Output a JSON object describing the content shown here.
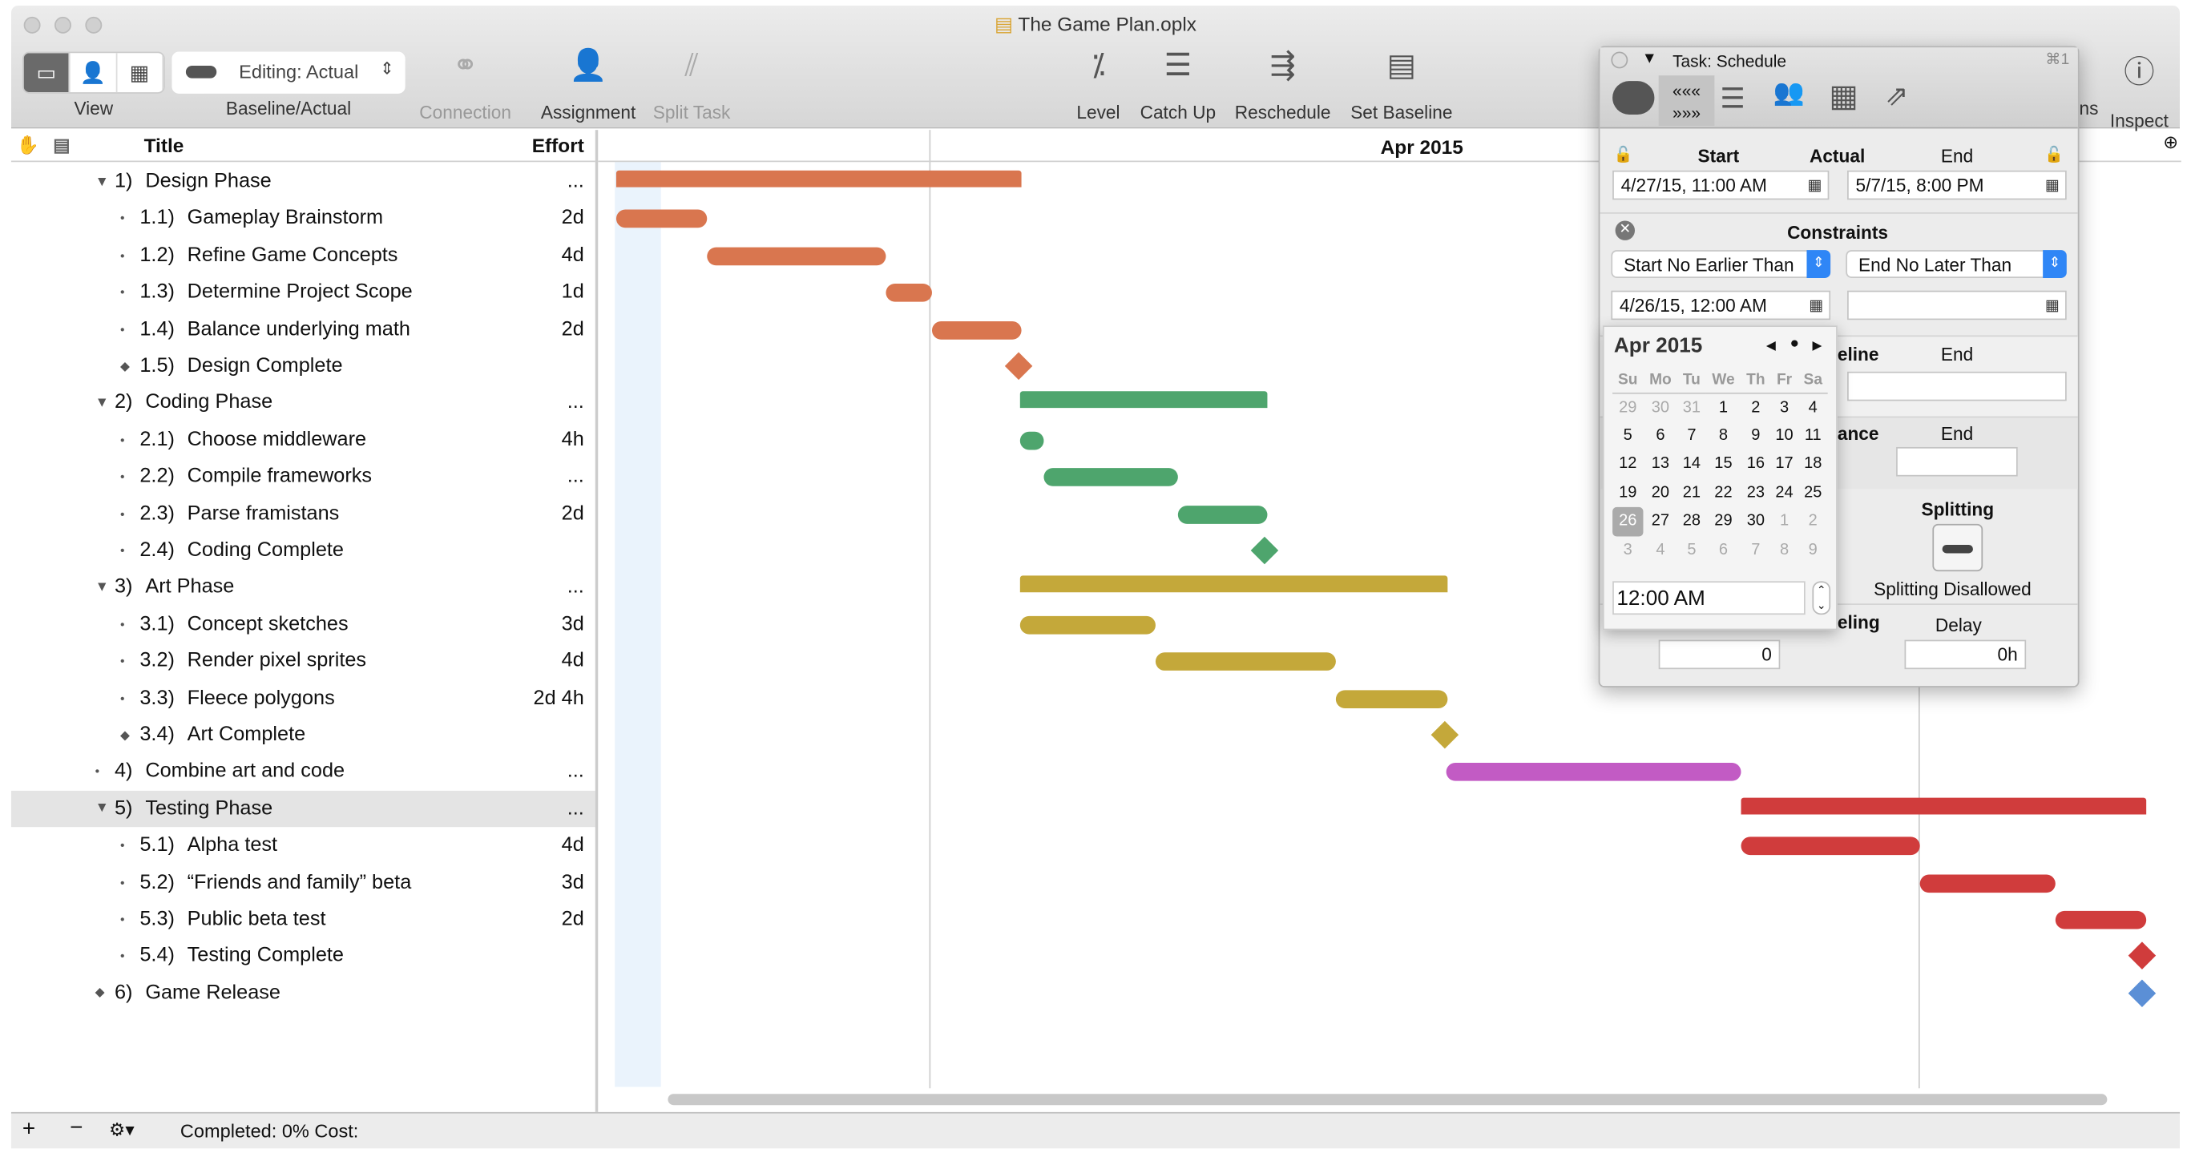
{
  "window": {
    "title": "The Game Plan.oplx"
  },
  "toolbar": {
    "view_label": "View",
    "baseline_select": "Editing: Actual",
    "baseline_label": "Baseline/Actual",
    "connection": "Connection",
    "assignment": "Assignment",
    "split_task": "Split Task",
    "level": "Level",
    "catch_up": "Catch Up",
    "reschedule": "Reschedule",
    "set_baseline": "Set Baseline",
    "hidden_ns": "ns",
    "inspect": "Inspect"
  },
  "outline": {
    "col_title": "Title",
    "col_effort": "Effort",
    "rows": [
      {
        "num": "1)",
        "title": "Design Phase",
        "effort": "...",
        "level": 0,
        "group": true
      },
      {
        "num": "1.1)",
        "title": "Gameplay Brainstorm",
        "effort": "2d",
        "level": 1
      },
      {
        "num": "1.2)",
        "title": "Refine Game Concepts",
        "effort": "4d",
        "level": 1
      },
      {
        "num": "1.3)",
        "title": "Determine Project Scope",
        "effort": "1d",
        "level": 1
      },
      {
        "num": "1.4)",
        "title": "Balance underlying math",
        "effort": "2d",
        "level": 1
      },
      {
        "num": "1.5)",
        "title": "Design Complete",
        "effort": "",
        "level": 1,
        "milestone": true
      },
      {
        "num": "2)",
        "title": "Coding Phase",
        "effort": "...",
        "level": 0,
        "group": true
      },
      {
        "num": "2.1)",
        "title": "Choose middleware",
        "effort": "4h",
        "level": 1
      },
      {
        "num": "2.2)",
        "title": "Compile frameworks",
        "effort": "...",
        "level": 1
      },
      {
        "num": "2.3)",
        "title": "Parse framistans",
        "effort": "2d",
        "level": 1
      },
      {
        "num": "2.4)",
        "title": "Coding Complete",
        "effort": "",
        "level": 1
      },
      {
        "num": "3)",
        "title": "Art Phase",
        "effort": "...",
        "level": 0,
        "group": true
      },
      {
        "num": "3.1)",
        "title": "Concept sketches",
        "effort": "3d",
        "level": 1
      },
      {
        "num": "3.2)",
        "title": "Render pixel sprites",
        "effort": "4d",
        "level": 1
      },
      {
        "num": "3.3)",
        "title": "Fleece polygons",
        "effort": "2d 4h",
        "level": 1
      },
      {
        "num": "3.4)",
        "title": "Art Complete",
        "effort": "",
        "level": 1,
        "milestone": true
      },
      {
        "num": "4)",
        "title": "Combine art and code",
        "effort": "...",
        "level": 0
      },
      {
        "num": "5)",
        "title": "Testing Phase",
        "effort": "...",
        "level": 0,
        "group": true,
        "selected": true
      },
      {
        "num": "5.1)",
        "title": "Alpha test",
        "effort": "4d",
        "level": 1
      },
      {
        "num": "5.2)",
        "title": "“Friends and family” beta",
        "effort": "3d",
        "level": 1
      },
      {
        "num": "5.3)",
        "title": "Public beta test",
        "effort": "2d",
        "level": 1
      },
      {
        "num": "5.4)",
        "title": "Testing Complete",
        "effort": "",
        "level": 1
      },
      {
        "num": "6)",
        "title": "Game Release",
        "effort": "",
        "level": 0,
        "milestone": true
      }
    ]
  },
  "gantt": {
    "month_label": "Apr 2015",
    "colors": {
      "design": "#d9764f",
      "coding": "#4ea56d",
      "art": "#c4a83a",
      "combine": "#c25bc4",
      "testing": "#d03c3c",
      "release": "#5b8fd6"
    }
  },
  "inspector": {
    "title": "Task: Schedule",
    "shortcut": "⌘1",
    "start_label": "Start",
    "actual_label": "Actual",
    "end_label": "End",
    "start_value": "4/27/15, 11:00 AM",
    "end_value": "5/7/15, 8:00 PM",
    "constraints_label": "Constraints",
    "constraint_start": "Start No Earlier Than",
    "constraint_end": "End No Later Than",
    "constraint_start_date": "4/26/15, 12:00 AM",
    "constraint_end_date": "",
    "baseline_partial": "eline",
    "baseline_end": "End",
    "variance_partial": "ance",
    "variance_end": "End",
    "splitting_label": "Splitting",
    "splitting_value": "Splitting Disallowed",
    "leveling_partial": "eling",
    "delay_label": "Delay",
    "priority_value": "0",
    "delay_value": "0h"
  },
  "calendar": {
    "month": "Apr 2015",
    "weekdays": [
      "Su",
      "Mo",
      "Tu",
      "We",
      "Th",
      "Fr",
      "Sa"
    ],
    "weeks": [
      [
        "29",
        "30",
        "31",
        "1",
        "2",
        "3",
        "4"
      ],
      [
        "5",
        "6",
        "7",
        "8",
        "9",
        "10",
        "11"
      ],
      [
        "12",
        "13",
        "14",
        "15",
        "16",
        "17",
        "18"
      ],
      [
        "19",
        "20",
        "21",
        "22",
        "23",
        "24",
        "25"
      ],
      [
        "26",
        "27",
        "28",
        "29",
        "30",
        "1",
        "2"
      ],
      [
        "3",
        "4",
        "5",
        "6",
        "7",
        "8",
        "9"
      ]
    ],
    "selected": "26",
    "time": "12:00 AM"
  },
  "status": {
    "text": "Completed: 0% Cost:"
  }
}
